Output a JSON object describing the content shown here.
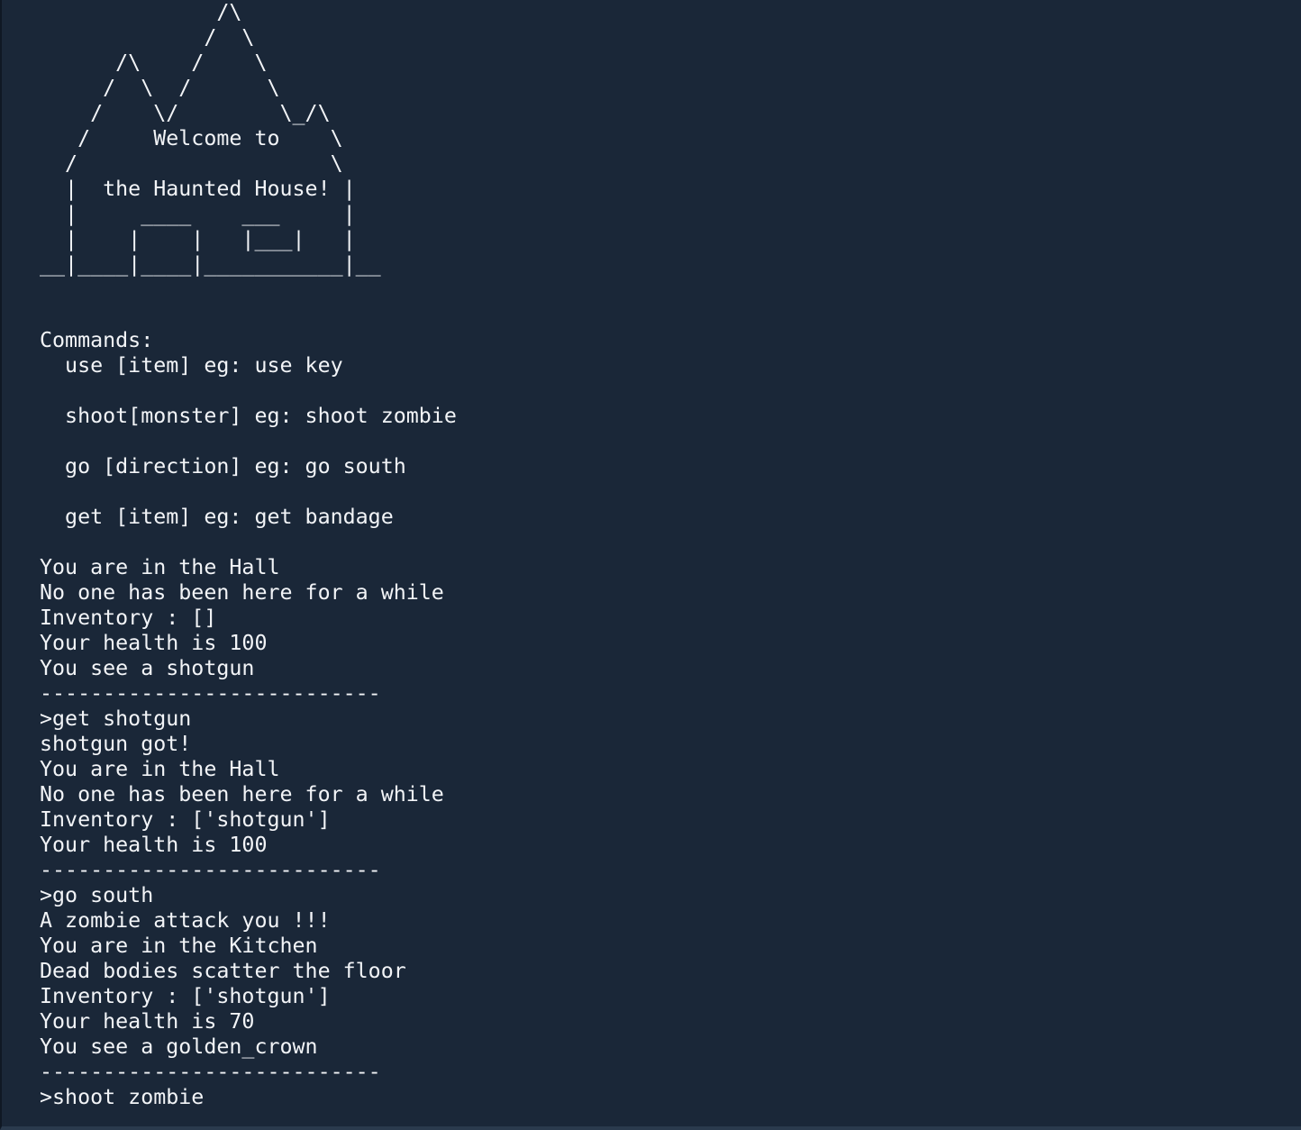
{
  "colors": {
    "background": "#1a2738",
    "text": "#f2f4f7"
  },
  "terminal": {
    "lines": [
      "              /\\",
      "             /  \\",
      "      /\\    /    \\",
      "     /  \\  /      \\",
      "    /    \\/        \\_/\\",
      "   /     Welcome to    \\",
      "  /                    \\",
      "  |  the Haunted House! |",
      "  |     ____    ___     |",
      "  |    |    |   |___|   |",
      "__|____|____|___________|__",
      "",
      "",
      "Commands:",
      "  use [item] eg: use key",
      "",
      "  shoot[monster] eg: shoot zombie",
      "",
      "  go [direction] eg: go south",
      "",
      "  get [item] eg: get bandage",
      "",
      "You are in the Hall",
      "No one has been here for a while",
      "Inventory : []",
      "Your health is 100",
      "You see a shotgun",
      "---------------------------",
      ">get shotgun",
      "shotgun got!",
      "You are in the Hall",
      "No one has been here for a while",
      "Inventory : ['shotgun']",
      "Your health is 100",
      "---------------------------",
      ">go south",
      "A zombie attack you !!!",
      "You are in the Kitchen",
      "Dead bodies scatter the floor",
      "Inventory : ['shotgun']",
      "Your health is 70",
      "You see a golden_crown",
      "---------------------------",
      ">shoot zombie"
    ]
  }
}
